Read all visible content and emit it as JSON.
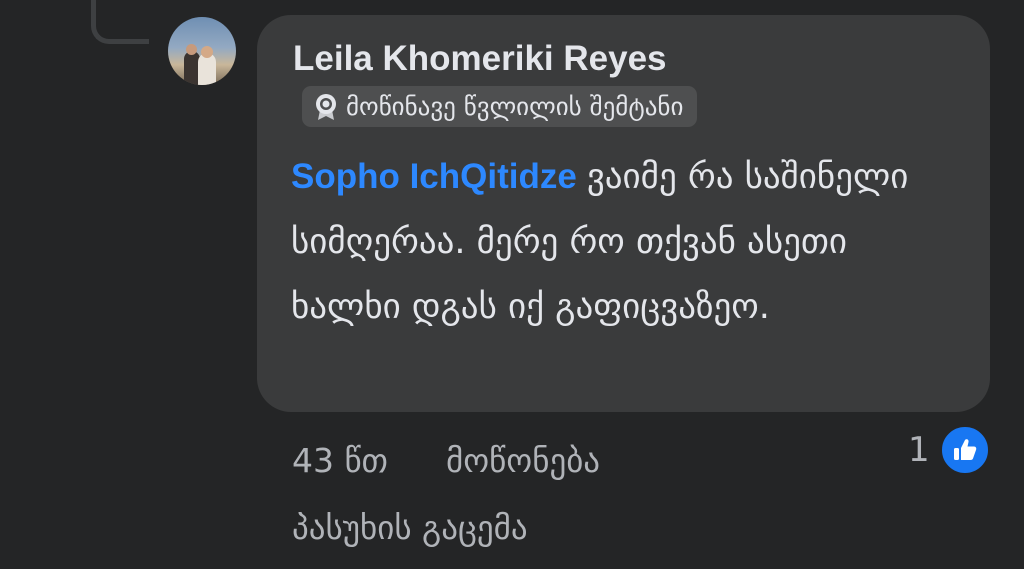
{
  "comment": {
    "author": "Leila Khomeriki Reyes",
    "badge": {
      "icon": "badge-icon",
      "label": "მოწინავე წვლილის შემტანი"
    },
    "mention": "Sopho IchQitidze",
    "text": "ვაიმე რა საშინელი სიმღერაა. მერე რო თქვან ასეთი ხალხი დგას იქ გაფიცვაზეო.",
    "time": "43 წთ",
    "like_action": "მოწონება",
    "reply_action": "პასუხის გაცემა",
    "reaction_count": "1",
    "reaction_icon": "like-icon"
  },
  "colors": {
    "background": "#242526",
    "bubble": "#3a3b3c",
    "badge": "#4e4f50",
    "mention": "#2d88ff",
    "like": "#1877f2",
    "text_primary": "#e4e6eb",
    "text_secondary": "#b0b3b8"
  }
}
